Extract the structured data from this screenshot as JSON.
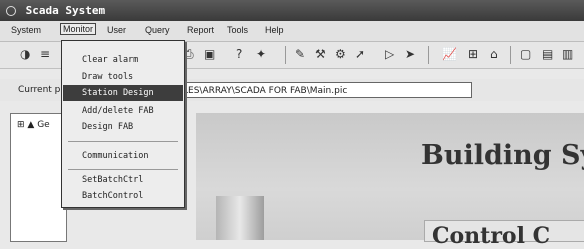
{
  "window": {
    "title": "Scada System"
  },
  "menubar": {
    "items": [
      "System",
      "Monitor",
      "User",
      "Query",
      "Report",
      "Tools",
      "Help"
    ]
  },
  "pathbar": {
    "label": "Current p",
    "path": "LES\\ARRAY\\SCADA FOR FAB\\Main.pic"
  },
  "tree": {
    "root": "Ge"
  },
  "dropdown": {
    "items": [
      "Clear alarm",
      "Draw tools",
      "Station Design",
      "Add/delete FAB",
      "Design FAB",
      "Communication",
      "SetBatchCtrl",
      "BatchControl"
    ],
    "selected_index": 2
  },
  "canvas": {
    "title": "Building Sy",
    "subtitle": "Control C"
  }
}
